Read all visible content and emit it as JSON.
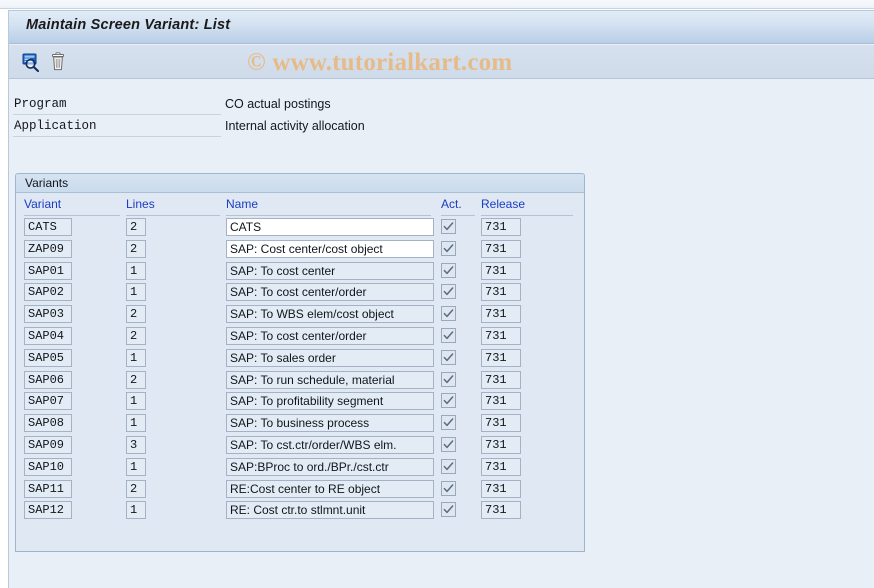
{
  "window": {
    "title": "Maintain Screen Variant: List"
  },
  "watermark": {
    "text": "© www.tutorialkart.com",
    "color": "#e6bb8a"
  },
  "toolbar": {
    "items": [
      {
        "name": "display-icon",
        "label": "Display",
        "tooltip": "Display"
      },
      {
        "name": "delete-icon",
        "label": "Delete",
        "tooltip": "Delete"
      }
    ]
  },
  "info": {
    "program_label": "Program",
    "program_value": "CO actual postings",
    "application_label": "Application",
    "application_value": "Internal activity allocation"
  },
  "panel": {
    "title": "Variants",
    "columns": {
      "variant": "Variant",
      "lines": "Lines",
      "name": "Name",
      "act": "Act.",
      "release": "Release"
    },
    "rows": [
      {
        "variant": "CATS",
        "lines": "2",
        "name": "CATS",
        "act": true,
        "release": "731",
        "editable": true
      },
      {
        "variant": "ZAP09",
        "lines": "2",
        "name": "SAP: Cost center/cost object",
        "act": true,
        "release": "731",
        "editable": true
      },
      {
        "variant": "SAP01",
        "lines": "1",
        "name": "SAP: To cost center",
        "act": true,
        "release": "731",
        "editable": false
      },
      {
        "variant": "SAP02",
        "lines": "1",
        "name": "SAP: To cost center/order",
        "act": true,
        "release": "731",
        "editable": false
      },
      {
        "variant": "SAP03",
        "lines": "2",
        "name": "SAP: To WBS elem/cost object",
        "act": true,
        "release": "731",
        "editable": false
      },
      {
        "variant": "SAP04",
        "lines": "2",
        "name": "SAP: To cost center/order",
        "act": true,
        "release": "731",
        "editable": false
      },
      {
        "variant": "SAP05",
        "lines": "1",
        "name": "SAP: To sales order",
        "act": true,
        "release": "731",
        "editable": false
      },
      {
        "variant": "SAP06",
        "lines": "2",
        "name": "SAP: To run schedule, material",
        "act": true,
        "release": "731",
        "editable": false
      },
      {
        "variant": "SAP07",
        "lines": "1",
        "name": "SAP: To profitability segment",
        "act": true,
        "release": "731",
        "editable": false
      },
      {
        "variant": "SAP08",
        "lines": "1",
        "name": "SAP: To business process",
        "act": true,
        "release": "731",
        "editable": false
      },
      {
        "variant": "SAP09",
        "lines": "3",
        "name": "SAP: To cst.ctr/order/WBS elm.",
        "act": true,
        "release": "731",
        "editable": false
      },
      {
        "variant": "SAP10",
        "lines": "1",
        "name": "SAP:BProc to ord./BPr./cst.ctr",
        "act": true,
        "release": "731",
        "editable": false
      },
      {
        "variant": "SAP11",
        "lines": "2",
        "name": "RE:Cost center to RE object",
        "act": true,
        "release": "731",
        "editable": false
      },
      {
        "variant": "SAP12",
        "lines": "1",
        "name": "RE: Cost ctr.to stlmnt.unit",
        "act": true,
        "release": "731",
        "editable": false
      }
    ]
  }
}
